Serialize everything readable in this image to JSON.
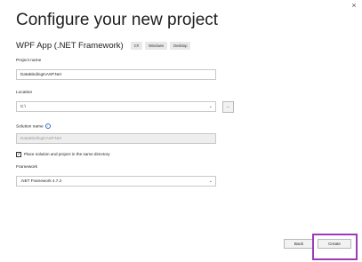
{
  "window": {
    "close_glyph": "×"
  },
  "header": {
    "title": "Configure your new project",
    "subtitle": "WPF App (.NET Framework)",
    "tags": [
      "C#",
      "Windows",
      "Desktop"
    ]
  },
  "form": {
    "project_name": {
      "label": "Project name",
      "value": "DataBindingInASP.Net"
    },
    "location": {
      "label": "Location",
      "value": "C:\\",
      "browse_label": "..."
    },
    "solution_name": {
      "label": "Solution name",
      "info_glyph": "i",
      "value": "DataBindingInASP.Net"
    },
    "same_directory": {
      "checked": true,
      "check_glyph": "✓",
      "label": "Place solution and project in the same directory"
    },
    "framework": {
      "label": "Framework",
      "value": ".NET Framework 4.7.2"
    },
    "dropdown_glyph": "⌄"
  },
  "footer": {
    "back_label": "Back",
    "create_label": "Create"
  },
  "colors": {
    "highlight": "#9d3ab8",
    "info": "#2f6fc9"
  }
}
